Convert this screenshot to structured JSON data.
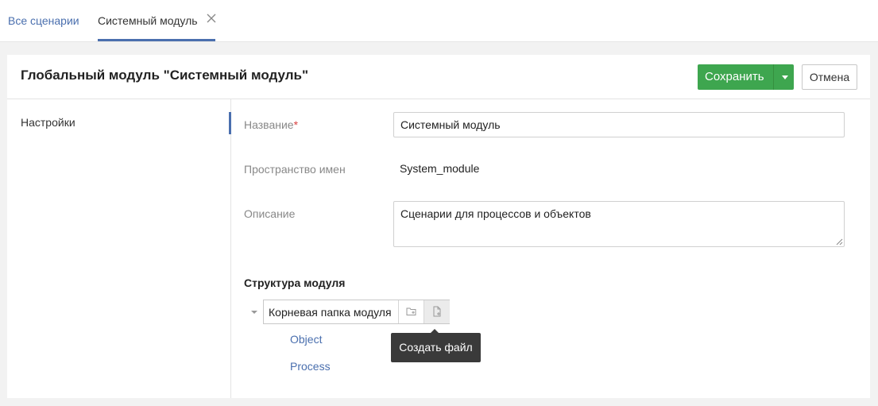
{
  "tabs": {
    "all_scenarios": "Все сценарии",
    "active": "Системный модуль"
  },
  "header": {
    "title": "Глобальный модуль \"Системный модуль\"",
    "save_label": "Сохранить",
    "cancel_label": "Отмена"
  },
  "sidebar": {
    "items": [
      {
        "label": "Настройки",
        "active": true
      }
    ]
  },
  "form": {
    "name": {
      "label": "Название",
      "required_mark": "*",
      "value": "Системный модуль"
    },
    "namespace": {
      "label": "Пространство имен",
      "value": "System_module"
    },
    "description": {
      "label": "Описание",
      "value": "Сценарии для процессов и объектов"
    }
  },
  "structure": {
    "title": "Структура модуля",
    "root_label": "Корневая папка модуля",
    "items": [
      "Object",
      "Process"
    ],
    "tooltip": "Создать файл"
  },
  "icons": {
    "close": "close-icon",
    "caret": "chevron-down-icon",
    "new_folder": "folder-plus-icon",
    "new_file": "file-plus-icon"
  },
  "colors": {
    "accent": "#4a6fae",
    "save": "#3ea64f",
    "required": "#d94141",
    "tooltip_bg": "#3a3a3a"
  }
}
